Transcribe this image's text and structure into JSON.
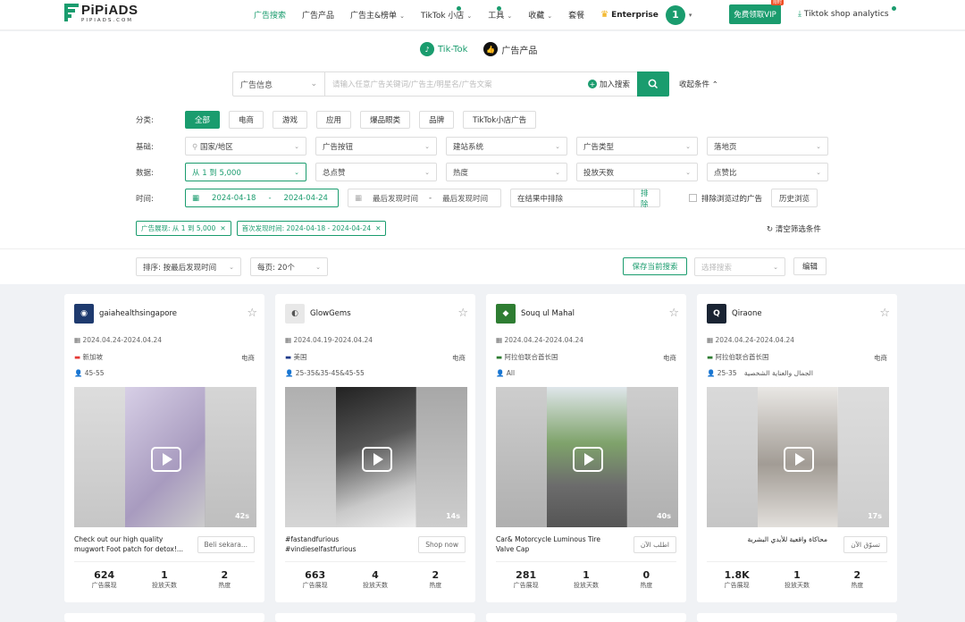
{
  "brand": {
    "name": "PiPiADS",
    "sub": "PIPIADS.COM"
  },
  "nav": [
    {
      "label": "广告搜索",
      "active": true,
      "chev": false,
      "dot": false
    },
    {
      "label": "广告产品",
      "active": false,
      "chev": false,
      "dot": false
    },
    {
      "label": "广告主&榜单",
      "active": false,
      "chev": true,
      "dot": false
    },
    {
      "label": "TikTok 小店",
      "active": false,
      "chev": true,
      "dot": true
    },
    {
      "label": "工具",
      "active": false,
      "chev": true,
      "dot": true
    },
    {
      "label": "收藏",
      "active": false,
      "chev": true,
      "dot": false
    },
    {
      "label": "套餐",
      "active": false,
      "chev": false,
      "dot": false
    }
  ],
  "plan": "Enterprise",
  "avatar": "1",
  "vip": {
    "label": "免费领取VIP",
    "badge": "限时"
  },
  "shop_analytics": "Tiktok shop analytics",
  "platform_tabs": {
    "tiktok": "Tik-Tok",
    "product": "广告产品"
  },
  "search": {
    "field": "广告信息",
    "placeholder": "请输入任意广告关键词/广告主/明星名/广告文案",
    "add": "加入搜索",
    "collapse": "收起条件"
  },
  "category": {
    "label": "分类:",
    "items": [
      "全部",
      "电商",
      "游戏",
      "应用",
      "爆品眼类",
      "品牌",
      "TikTok小店广告"
    ]
  },
  "basic": {
    "label": "基础:",
    "items": [
      "国家/地区",
      "广告按钮",
      "建站系统",
      "广告类型",
      "落地页"
    ]
  },
  "metrics": {
    "label": "数据:",
    "items": [
      "从 1 到 5,000",
      "总点赞",
      "热度",
      "投放天数",
      "点赞比"
    ]
  },
  "time": {
    "label": "时间:",
    "start": "2024-04-18",
    "dash": "-",
    "end": "2024-04-24",
    "last_start": "最后发现时间",
    "last_end": "最后发现时间",
    "exclude_ph": "在结果中排除",
    "exclude_btn": "排除",
    "skip": "排除浏览过的广告",
    "history": "历史浏览"
  },
  "active_tags": [
    "广告展现: 从 1 到 5,000",
    "首次发现时间: 2024-04-18 - 2024-04-24"
  ],
  "clear": "清空筛选条件",
  "sort": {
    "order": "排序: 按最后发现时间",
    "per_page": "每页: 20个",
    "save": "保存当前搜索",
    "choose": "选择搜索",
    "edit": "编辑"
  },
  "stat_labels": [
    "广告展现",
    "投放天数",
    "热度"
  ],
  "cards": [
    {
      "name": "gaiahealthsingapore",
      "date": "2024.04.24-2024.04.24",
      "geo": "新加坡",
      "category": "电商",
      "age": "45-55",
      "duration": "42s",
      "desc": "Check out our high quality mugwort Foot patch for detox!...",
      "cta": "Beli sekara...",
      "stats": [
        "624",
        "1",
        "2"
      ],
      "avatar_color": "#1e3a6e"
    },
    {
      "name": "GlowGems",
      "date": "2024.04.19-2024.04.24",
      "geo": "美国",
      "category": "电商",
      "age": "25-35&35-45&45-55",
      "duration": "14s",
      "desc": "#fastandfurious #vindieselfastfurious #vindieselfa...",
      "cta": "Shop now",
      "stats": [
        "663",
        "4",
        "2"
      ],
      "avatar_color": "#bbbbbb"
    },
    {
      "name": "Souq ul Mahal",
      "date": "2024.04.24-2024.04.24",
      "geo": "阿拉伯联合酋长国",
      "category": "电商",
      "age": "All",
      "duration": "40s",
      "desc": "Car& Motorcycle Luminous Tire Valve Cap",
      "cta": "اطلب الآن",
      "stats": [
        "281",
        "1",
        "0"
      ],
      "avatar_color": "#2e7d32"
    },
    {
      "name": "Qiraone",
      "date": "2024.04.24-2024.04.24",
      "geo": "阿拉伯联合酋长国",
      "category": "الجمال والعناية الشخصية",
      "age": "25-35",
      "duration": "17s",
      "desc": "محاكاة واقعية للأيدي البشرية",
      "cta": "تسوّق الآن",
      "stats": [
        "1.8K",
        "1",
        "2"
      ],
      "avatar_color": "#1a2433"
    }
  ]
}
